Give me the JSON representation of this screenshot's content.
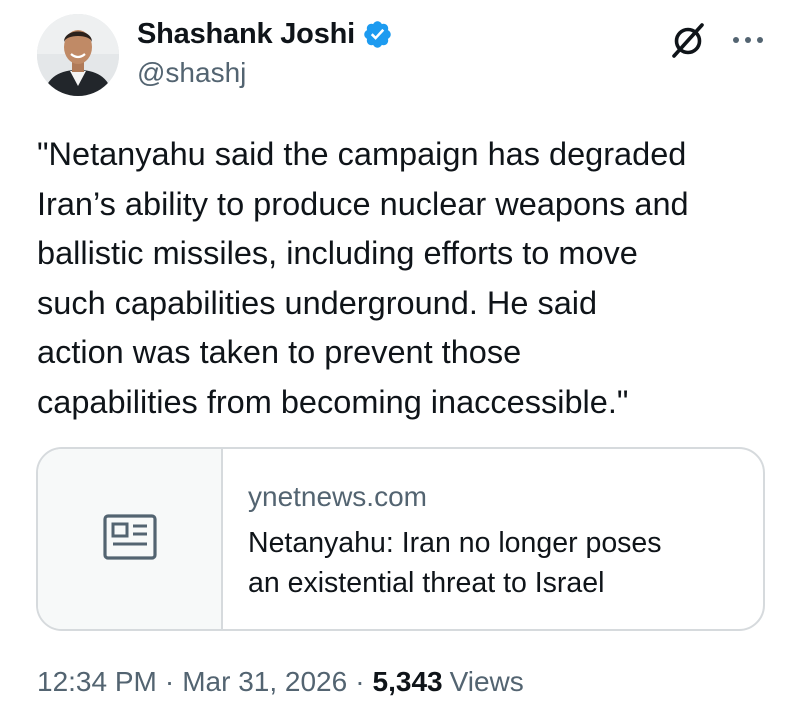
{
  "author": {
    "display_name": "Shashank Joshi",
    "handle": "@shashj",
    "verified": true,
    "avatar_icon": "profile-photo"
  },
  "header_actions": [
    {
      "icon": "grok-icon"
    },
    {
      "icon": "more-horizontal-icon"
    }
  ],
  "tweet": {
    "text": "\"Netanyahu said the campaign has degraded\nIran’s ability to produce nuclear weapons and\nballistic missiles, including efforts to move\nsuch capabilities underground. He said\naction was taken to prevent those\ncapabilities from becoming inaccessible.\""
  },
  "link_card": {
    "icon": "article-icon",
    "domain": "ynetnews.com",
    "title": "Netanyahu: Iran no longer poses\nan existential threat to Israel"
  },
  "meta": {
    "time": "12:34 PM",
    "separator": "·",
    "date": "Mar 31, 2026",
    "views_count": "5,343",
    "views_label": "Views"
  },
  "colors": {
    "text": "#0f1419",
    "secondary": "#536471",
    "border": "#d6dadd",
    "verified": "#1d9bf0"
  }
}
